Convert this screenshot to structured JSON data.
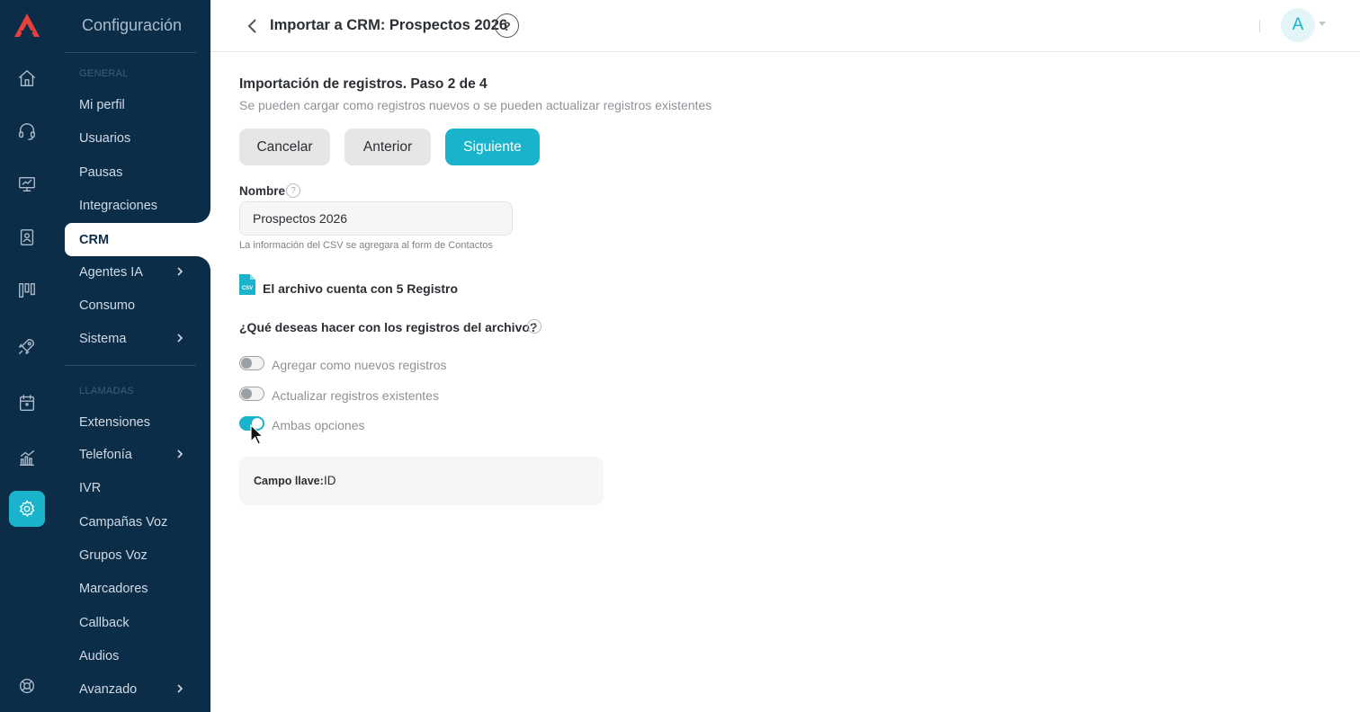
{
  "colors": {
    "accent": "#19b3cc",
    "sidebar_bg": "#0c2d48",
    "logo": "#e8413c"
  },
  "rail": {
    "items": [
      {
        "name": "home-icon",
        "active": false
      },
      {
        "name": "headset-icon",
        "active": false
      },
      {
        "name": "monitor-icon",
        "active": false
      },
      {
        "name": "contacts-book-icon",
        "active": false
      },
      {
        "name": "kanban-icon",
        "active": false
      },
      {
        "name": "rocket-icon",
        "active": false
      },
      {
        "name": "calendar-icon",
        "active": false
      },
      {
        "name": "analytics-icon",
        "active": false
      },
      {
        "name": "gear-icon",
        "active": true
      },
      {
        "name": "lifebuoy-icon",
        "active": false
      }
    ]
  },
  "sidebar": {
    "title": "Configuración",
    "sections": {
      "general": "GENERAL",
      "llamadas": "LLAMADAS"
    },
    "items": [
      {
        "label": "Mi perfil"
      },
      {
        "label": "Usuarios"
      },
      {
        "label": "Pausas"
      },
      {
        "label": "Integraciones"
      },
      {
        "label": "CRM",
        "active": true
      },
      {
        "label": "Agentes IA",
        "has_children": true
      },
      {
        "label": "Consumo"
      },
      {
        "label": "Sistema",
        "has_children": true
      },
      {
        "label": "Extensiones"
      },
      {
        "label": "Telefonía",
        "has_children": true
      },
      {
        "label": "IVR"
      },
      {
        "label": "Campañas Voz"
      },
      {
        "label": "Grupos Voz"
      },
      {
        "label": "Marcadores"
      },
      {
        "label": "Callback"
      },
      {
        "label": "Audios"
      },
      {
        "label": "Avanzado",
        "has_children": true
      }
    ]
  },
  "header": {
    "title": "Importar a CRM: Prospectos 2026",
    "help": "?",
    "avatar_initial": "A"
  },
  "main": {
    "step_title": "Importación de registros. Paso 2 de 4",
    "step_subtitle": "Se pueden cargar como registros nuevos o se pueden actualizar registros existentes",
    "buttons": {
      "cancel": "Cancelar",
      "previous": "Anterior",
      "next": "Siguiente"
    },
    "name_field": {
      "label": "Nombre",
      "value": "Prospectos 2026",
      "hint": "La información del CSV se agregara al form de Contactos"
    },
    "file": {
      "icon_text": "CSV",
      "summary": "El archivo cuenta con 5 Registro"
    },
    "question": "¿Qué deseas hacer con los registros del archivo?",
    "options": [
      {
        "label": "Agregar como nuevos registros",
        "checked": false
      },
      {
        "label": "Actualizar registros existentes",
        "checked": false
      },
      {
        "label": "Ambas opciones",
        "checked": true
      }
    ],
    "key_field": {
      "label": "Campo llave:",
      "value": "ID"
    }
  }
}
